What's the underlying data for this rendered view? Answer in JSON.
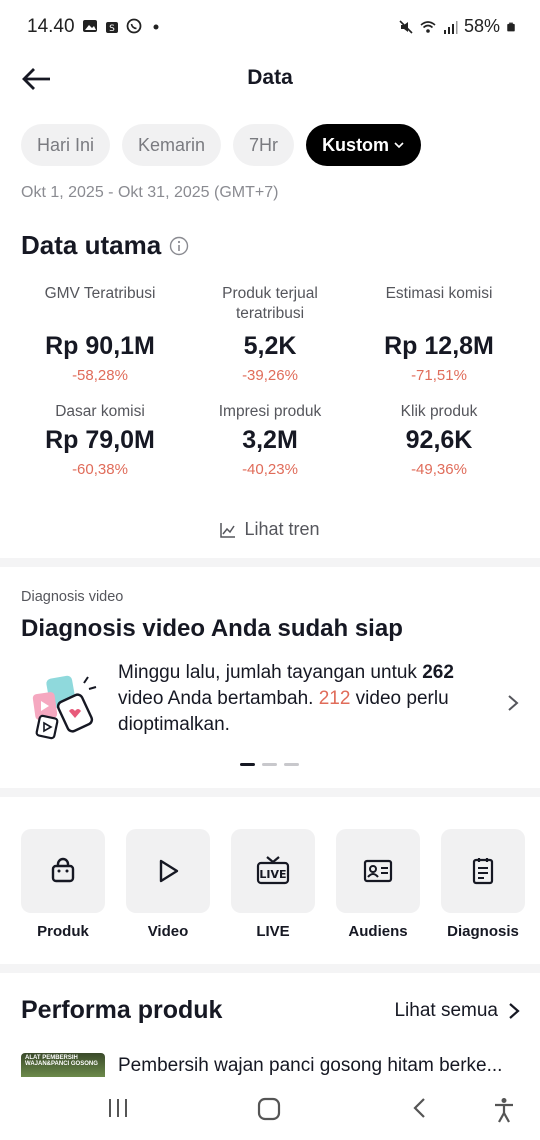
{
  "status_bar": {
    "time": "14.40",
    "battery": "58%",
    "icons": [
      "gallery-icon",
      "shop-icon",
      "whatsapp-icon",
      "dot-icon",
      "mute-icon",
      "wifi-icon",
      "signal-icon",
      "battery-icon"
    ]
  },
  "header": {
    "title": "Data"
  },
  "filters": {
    "chips": [
      "Hari Ini",
      "Kemarin",
      "7Hr",
      "Kustom"
    ],
    "active": "Kustom",
    "date_range": "Okt 1, 2025 - Okt 31, 2025 (GMT+7)"
  },
  "main_data": {
    "title": "Data utama",
    "metrics": [
      {
        "label": "GMV Teratribusi",
        "value": "Rp 90,1M",
        "change": "-58,28%"
      },
      {
        "label": "Produk terjual teratribusi",
        "value": "5,2K",
        "change": "-39,26%"
      },
      {
        "label": "Estimasi komisi",
        "value": "Rp 12,8M",
        "change": "-71,51%"
      },
      {
        "label": "Dasar komisi",
        "value": "Rp 79,0M",
        "change": "-60,38%"
      },
      {
        "label": "Impresi produk",
        "value": "3,2M",
        "change": "-40,23%"
      },
      {
        "label": "Klik produk",
        "value": "92,6K",
        "change": "-49,36%"
      }
    ],
    "trend_link": "Lihat tren"
  },
  "diagnosis": {
    "small_label": "Diagnosis video",
    "title": "Diagnosis video Anda sudah siap",
    "text_1": "Minggu lalu, jumlah tayangan untuk ",
    "count_1": "262",
    "text_2": " video Anda bertambah. ",
    "count_2": "212",
    "text_3": " video perlu dioptimalkan.",
    "pages": 3,
    "active_page": 1
  },
  "tools": [
    {
      "label": "Produk",
      "icon": "shopping-bag-icon"
    },
    {
      "label": "Video",
      "icon": "play-icon"
    },
    {
      "label": "LIVE",
      "icon": "live-tv-icon"
    },
    {
      "label": "Audiens",
      "icon": "id-card-icon"
    },
    {
      "label": "Diagnosis",
      "icon": "clipboard-icon"
    }
  ],
  "performance": {
    "title": "Performa produk",
    "see_all": "Lihat semua",
    "first_product": "Pembersih wajan panci gosong hitam berke...",
    "thumb_text": "ALAT PEMBERSIH WAJAN&PANCI GOSONG"
  },
  "accent_colors": {
    "negative": "#e06c5a",
    "active_chip": "#000000"
  }
}
